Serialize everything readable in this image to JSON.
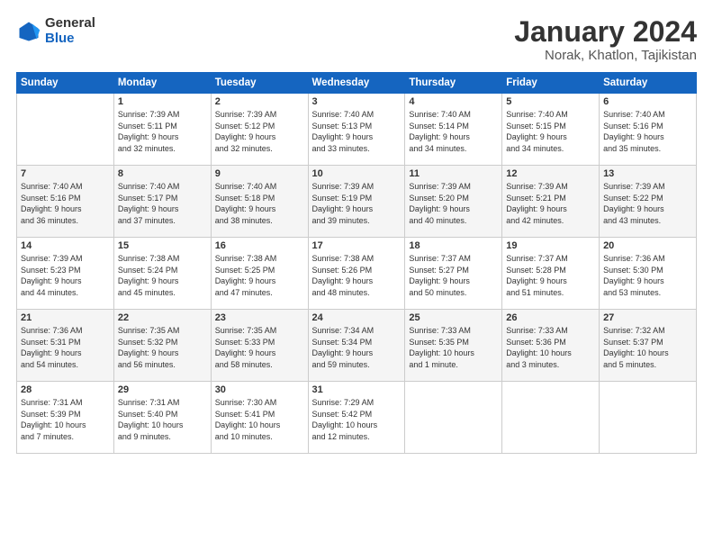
{
  "header": {
    "logo_general": "General",
    "logo_blue": "Blue",
    "title": "January 2024",
    "location": "Norak, Khatlon, Tajikistan"
  },
  "weekdays": [
    "Sunday",
    "Monday",
    "Tuesday",
    "Wednesday",
    "Thursday",
    "Friday",
    "Saturday"
  ],
  "weeks": [
    [
      {
        "day": "",
        "info": ""
      },
      {
        "day": "1",
        "info": "Sunrise: 7:39 AM\nSunset: 5:11 PM\nDaylight: 9 hours\nand 32 minutes."
      },
      {
        "day": "2",
        "info": "Sunrise: 7:39 AM\nSunset: 5:12 PM\nDaylight: 9 hours\nand 32 minutes."
      },
      {
        "day": "3",
        "info": "Sunrise: 7:40 AM\nSunset: 5:13 PM\nDaylight: 9 hours\nand 33 minutes."
      },
      {
        "day": "4",
        "info": "Sunrise: 7:40 AM\nSunset: 5:14 PM\nDaylight: 9 hours\nand 34 minutes."
      },
      {
        "day": "5",
        "info": "Sunrise: 7:40 AM\nSunset: 5:15 PM\nDaylight: 9 hours\nand 34 minutes."
      },
      {
        "day": "6",
        "info": "Sunrise: 7:40 AM\nSunset: 5:16 PM\nDaylight: 9 hours\nand 35 minutes."
      }
    ],
    [
      {
        "day": "7",
        "info": "Sunrise: 7:40 AM\nSunset: 5:16 PM\nDaylight: 9 hours\nand 36 minutes."
      },
      {
        "day": "8",
        "info": "Sunrise: 7:40 AM\nSunset: 5:17 PM\nDaylight: 9 hours\nand 37 minutes."
      },
      {
        "day": "9",
        "info": "Sunrise: 7:40 AM\nSunset: 5:18 PM\nDaylight: 9 hours\nand 38 minutes."
      },
      {
        "day": "10",
        "info": "Sunrise: 7:39 AM\nSunset: 5:19 PM\nDaylight: 9 hours\nand 39 minutes."
      },
      {
        "day": "11",
        "info": "Sunrise: 7:39 AM\nSunset: 5:20 PM\nDaylight: 9 hours\nand 40 minutes."
      },
      {
        "day": "12",
        "info": "Sunrise: 7:39 AM\nSunset: 5:21 PM\nDaylight: 9 hours\nand 42 minutes."
      },
      {
        "day": "13",
        "info": "Sunrise: 7:39 AM\nSunset: 5:22 PM\nDaylight: 9 hours\nand 43 minutes."
      }
    ],
    [
      {
        "day": "14",
        "info": "Sunrise: 7:39 AM\nSunset: 5:23 PM\nDaylight: 9 hours\nand 44 minutes."
      },
      {
        "day": "15",
        "info": "Sunrise: 7:38 AM\nSunset: 5:24 PM\nDaylight: 9 hours\nand 45 minutes."
      },
      {
        "day": "16",
        "info": "Sunrise: 7:38 AM\nSunset: 5:25 PM\nDaylight: 9 hours\nand 47 minutes."
      },
      {
        "day": "17",
        "info": "Sunrise: 7:38 AM\nSunset: 5:26 PM\nDaylight: 9 hours\nand 48 minutes."
      },
      {
        "day": "18",
        "info": "Sunrise: 7:37 AM\nSunset: 5:27 PM\nDaylight: 9 hours\nand 50 minutes."
      },
      {
        "day": "19",
        "info": "Sunrise: 7:37 AM\nSunset: 5:28 PM\nDaylight: 9 hours\nand 51 minutes."
      },
      {
        "day": "20",
        "info": "Sunrise: 7:36 AM\nSunset: 5:30 PM\nDaylight: 9 hours\nand 53 minutes."
      }
    ],
    [
      {
        "day": "21",
        "info": "Sunrise: 7:36 AM\nSunset: 5:31 PM\nDaylight: 9 hours\nand 54 minutes."
      },
      {
        "day": "22",
        "info": "Sunrise: 7:35 AM\nSunset: 5:32 PM\nDaylight: 9 hours\nand 56 minutes."
      },
      {
        "day": "23",
        "info": "Sunrise: 7:35 AM\nSunset: 5:33 PM\nDaylight: 9 hours\nand 58 minutes."
      },
      {
        "day": "24",
        "info": "Sunrise: 7:34 AM\nSunset: 5:34 PM\nDaylight: 9 hours\nand 59 minutes."
      },
      {
        "day": "25",
        "info": "Sunrise: 7:33 AM\nSunset: 5:35 PM\nDaylight: 10 hours\nand 1 minute."
      },
      {
        "day": "26",
        "info": "Sunrise: 7:33 AM\nSunset: 5:36 PM\nDaylight: 10 hours\nand 3 minutes."
      },
      {
        "day": "27",
        "info": "Sunrise: 7:32 AM\nSunset: 5:37 PM\nDaylight: 10 hours\nand 5 minutes."
      }
    ],
    [
      {
        "day": "28",
        "info": "Sunrise: 7:31 AM\nSunset: 5:39 PM\nDaylight: 10 hours\nand 7 minutes."
      },
      {
        "day": "29",
        "info": "Sunrise: 7:31 AM\nSunset: 5:40 PM\nDaylight: 10 hours\nand 9 minutes."
      },
      {
        "day": "30",
        "info": "Sunrise: 7:30 AM\nSunset: 5:41 PM\nDaylight: 10 hours\nand 10 minutes."
      },
      {
        "day": "31",
        "info": "Sunrise: 7:29 AM\nSunset: 5:42 PM\nDaylight: 10 hours\nand 12 minutes."
      },
      {
        "day": "",
        "info": ""
      },
      {
        "day": "",
        "info": ""
      },
      {
        "day": "",
        "info": ""
      }
    ]
  ]
}
